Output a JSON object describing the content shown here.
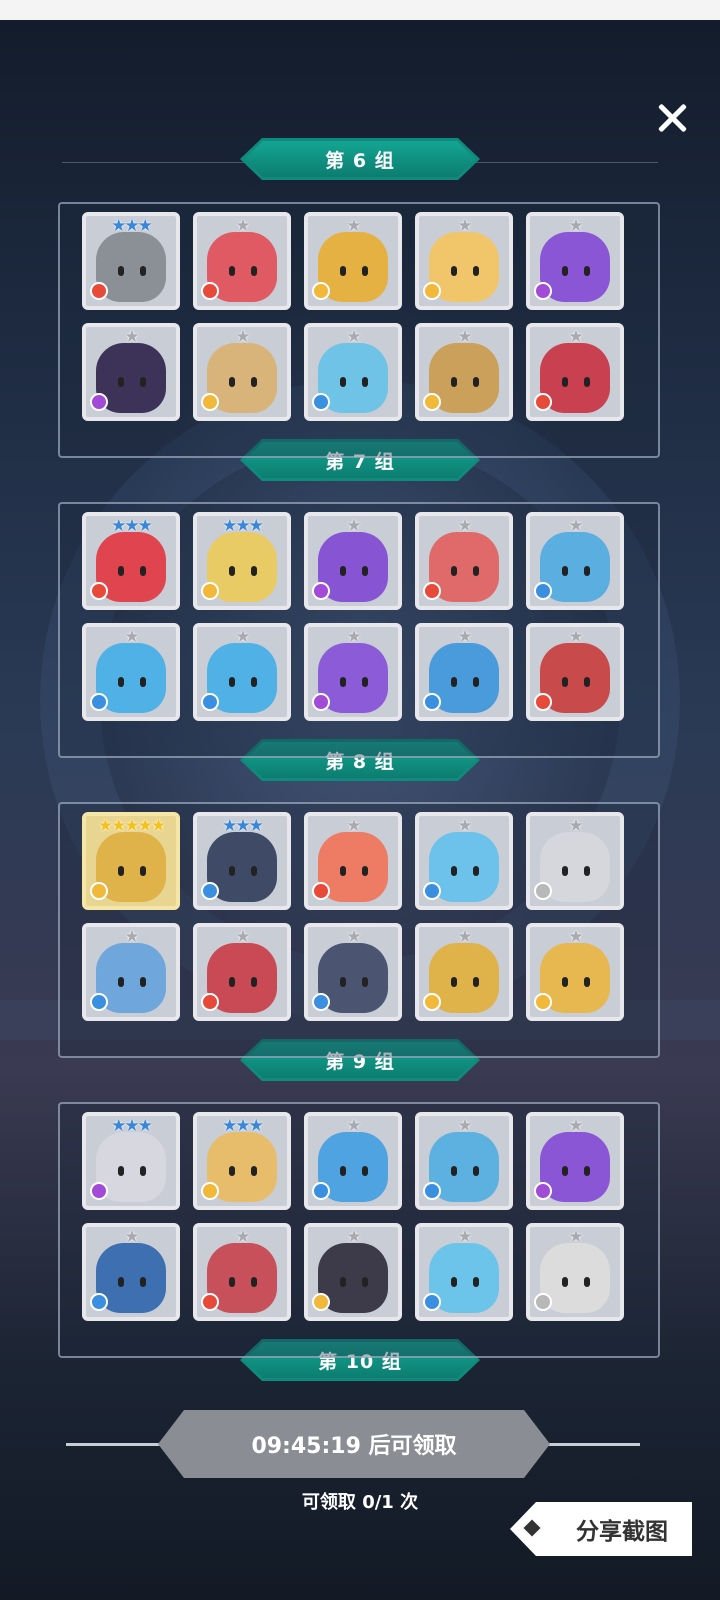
{
  "close_icon": "close-icon",
  "groups": [
    {
      "label": "第 6 组"
    },
    {
      "label": "第 7 组"
    },
    {
      "label": "第 8 组"
    },
    {
      "label": "第 9 组"
    },
    {
      "label": "第 10 组"
    }
  ],
  "panels": [
    {
      "heroes": [
        {
          "stars": "★★★",
          "tier": "blue",
          "element": "fire",
          "color": "#8b8f96"
        },
        {
          "stars": "★",
          "tier": "silver",
          "element": "fire",
          "color": "#e05a63"
        },
        {
          "stars": "★",
          "tier": "silver",
          "element": "wind",
          "color": "#e6b143"
        },
        {
          "stars": "★",
          "tier": "silver",
          "element": "wind",
          "color": "#f1c56a"
        },
        {
          "stars": "★",
          "tier": "silver",
          "element": "dark",
          "color": "#8a56d6"
        },
        {
          "stars": "★",
          "tier": "silver",
          "element": "dark",
          "color": "#3d3358"
        },
        {
          "stars": "★",
          "tier": "silver",
          "element": "wind",
          "color": "#d9b47a"
        },
        {
          "stars": "★",
          "tier": "silver",
          "element": "water",
          "color": "#6ec3e6"
        },
        {
          "stars": "★",
          "tier": "silver",
          "element": "wind",
          "color": "#caa05b"
        },
        {
          "stars": "★",
          "tier": "silver",
          "element": "fire",
          "color": "#c94150"
        }
      ]
    },
    {
      "heroes": [
        {
          "stars": "★★★",
          "tier": "blue",
          "element": "fire",
          "color": "#e0454f"
        },
        {
          "stars": "★★★",
          "tier": "blue",
          "element": "wind",
          "color": "#e8cb64"
        },
        {
          "stars": "★",
          "tier": "silver",
          "element": "dark",
          "color": "#8755d4"
        },
        {
          "stars": "★",
          "tier": "silver",
          "element": "fire",
          "color": "#e06a6a"
        },
        {
          "stars": "★",
          "tier": "silver",
          "element": "water",
          "color": "#5aaee0"
        },
        {
          "stars": "★",
          "tier": "silver",
          "element": "water",
          "color": "#4fb1e6"
        },
        {
          "stars": "★",
          "tier": "silver",
          "element": "water",
          "color": "#4fb1e6"
        },
        {
          "stars": "★",
          "tier": "silver",
          "element": "dark",
          "color": "#8c5bd8"
        },
        {
          "stars": "★",
          "tier": "silver",
          "element": "water",
          "color": "#4a9bdc"
        },
        {
          "stars": "★",
          "tier": "silver",
          "element": "fire",
          "color": "#c94a4a"
        }
      ]
    },
    {
      "heroes": [
        {
          "stars": "★★★★★",
          "tier": "gold",
          "element": "wind",
          "color": "#e0b34a"
        },
        {
          "stars": "★★★",
          "tier": "blue",
          "element": "water",
          "color": "#3e4a66"
        },
        {
          "stars": "★",
          "tier": "silver",
          "element": "fire",
          "color": "#ee7b63"
        },
        {
          "stars": "★",
          "tier": "silver",
          "element": "water",
          "color": "#6cc2ea"
        },
        {
          "stars": "★",
          "tier": "silver",
          "element": "light",
          "color": "#d6d7dc"
        },
        {
          "stars": "★",
          "tier": "silver",
          "element": "water",
          "color": "#6fa6dc"
        },
        {
          "stars": "★",
          "tier": "silver",
          "element": "fire",
          "color": "#c94a55"
        },
        {
          "stars": "★",
          "tier": "silver",
          "element": "water",
          "color": "#4b5572"
        },
        {
          "stars": "★",
          "tier": "silver",
          "element": "wind",
          "color": "#e0b24a"
        },
        {
          "stars": "★",
          "tier": "silver",
          "element": "wind",
          "color": "#e6b84f"
        }
      ]
    },
    {
      "heroes": [
        {
          "stars": "★★★",
          "tier": "blue",
          "element": "dark",
          "color": "#d7d7e0"
        },
        {
          "stars": "★★★",
          "tier": "blue",
          "element": "wind",
          "color": "#e7bd6b"
        },
        {
          "stars": "★",
          "tier": "silver",
          "element": "water",
          "color": "#4fa3e0"
        },
        {
          "stars": "★",
          "tier": "silver",
          "element": "water",
          "color": "#5cb1e0"
        },
        {
          "stars": "★",
          "tier": "silver",
          "element": "dark",
          "color": "#8a56d6"
        },
        {
          "stars": "★",
          "tier": "silver",
          "element": "water",
          "color": "#3e6fb0"
        },
        {
          "stars": "★",
          "tier": "silver",
          "element": "fire",
          "color": "#c8505a"
        },
        {
          "stars": "★",
          "tier": "silver",
          "element": "wind",
          "color": "#3d3a4a"
        },
        {
          "stars": "★",
          "tier": "silver",
          "element": "water",
          "color": "#6cc4ea"
        },
        {
          "stars": "★",
          "tier": "silver",
          "element": "light",
          "color": "#dcdcdc"
        }
      ]
    }
  ],
  "claim": {
    "timer_text": "09:45:19 后可领取",
    "count_text": "可领取 0/1 次"
  },
  "share": {
    "label": "分享截图",
    "icon": "diamond-icon"
  },
  "element_colors": {
    "fire": "#e84a3a",
    "wind": "#f2b83a",
    "water": "#3b8fe0",
    "dark": "#a24bd6",
    "light": "#b8b8b8"
  }
}
